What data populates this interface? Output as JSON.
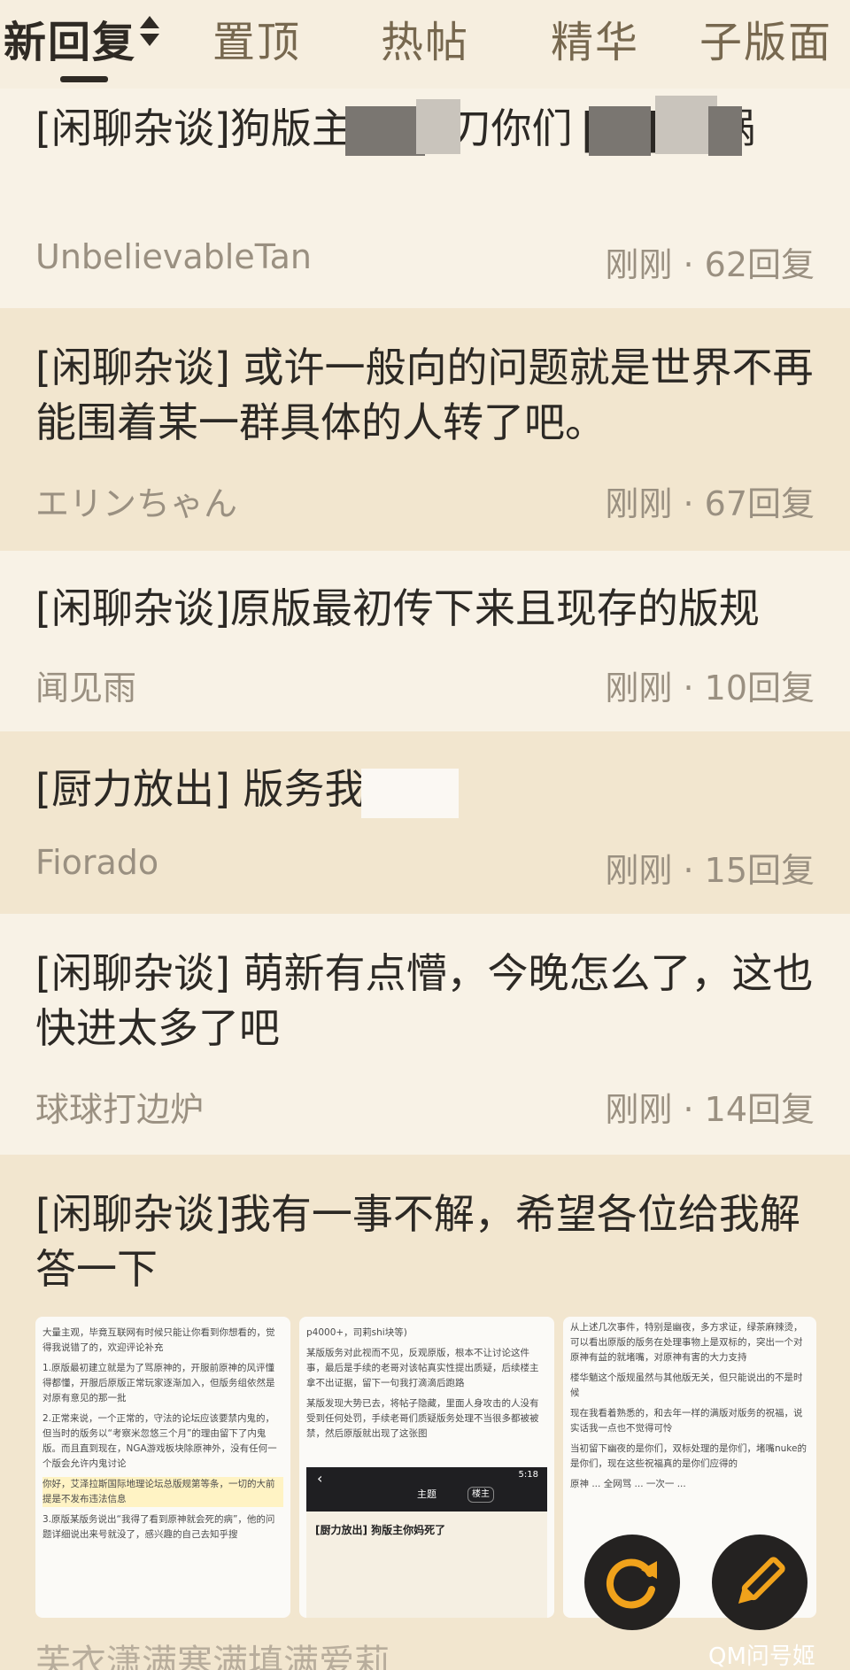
{
  "tabs": [
    {
      "label": "新回复",
      "active": true
    },
    {
      "label": "置顶",
      "active": false
    },
    {
      "label": "热帖",
      "active": false
    },
    {
      "label": "精华",
      "active": false
    },
    {
      "label": "子版面",
      "active": false
    }
  ],
  "threads": [
    {
      "title": "[闲聊杂谈]狗版主和 ▇ 刀你们 ▇ ▇ 帖锅",
      "author": "UnbelievableTan",
      "meta": "刚刚 · 62回复"
    },
    {
      "title": "[闲聊杂谈] 或许一般向的问题就是世界不再能围着某一群具体的人转了吧。",
      "author": "エリンちゃん",
      "meta": "刚刚 · 67回复"
    },
    {
      "title": "[闲聊杂谈]原版最初传下来且现存的版规",
      "author": "闻见雨",
      "meta": "刚刚 · 10回复"
    },
    {
      "title": "[厨力放出] 版务我        马",
      "author": "Fiorado",
      "meta": "刚刚 · 15回复"
    },
    {
      "title": "[闲聊杂谈] 萌新有点懵，今晚怎么了，这也快进太多了吧",
      "author": "球球打边炉",
      "meta": "刚刚 · 14回复"
    },
    {
      "title": "[闲聊杂谈]我有一事不解，希望各位给我解答一下",
      "author": "",
      "meta": ""
    }
  ],
  "thumbnails": [
    {
      "paragraphs": [
        "大量主观，毕竟互联网有时候只能让你看到你想看的，觉得我说错了的，欢迎评论补充",
        "1.原版最初建立就是为了骂原神的，开服前原神的风评懂得都懂，开服后原版正常玩家逐渐加入，但版务组依然是对原有意见的那一批",
        "2.正常来说，一个正常的，守法的论坛应该要禁内鬼的，但当时的版务以“考察米忽悠三个月”的理由留下了内鬼版。而且直到现在，NGA游戏板块除原神外，没有任何一个版会允许内鬼讨论",
        "你好，艾泽拉斯国际地理论坛总版规第等条，一切的大前提是不发布违法信息",
        "3.原版某版务说出“我得了看到原神就会死的病”，他的问题详细说出来号就没了，感兴趣的自己去知乎搜"
      ]
    },
    {
      "paragraphs": [
        "p4000+，司莉shi块等)",
        "某版版务对此视而不见，反观原版，根本不让讨论这件事，最后是手续的老哥对该帖真实性提出质疑，后续楼主拿不出证据，留下一句我打滴滴后跑路",
        "某版发现大势已去，将帖子隐藏，里面人身攻击的人没有受到任何处罚，手续老哥们质疑版务处理不当很多都被被禁，然后原版就出现了这张图"
      ],
      "mini_bar": "主题",
      "mini_badge": "楼主",
      "mini_time": "5:18",
      "mini_title": "[厨力放出] 狗版主你妈死了"
    },
    {
      "paragraphs": [
        "从上述几次事件，特别是幽夜，多方求证，绿茶麻辣烫，可以看出原版的版务在处理事物上是双标的，突出一个对原神有益的就堵嘴，对原神有害的大力支持",
        "楼华魈这个版规虽然与其他版无关，但只能说出的不是时候",
        "现在我看着熟悉的，和去年一样的满版对版务的祝福，说实话我一点也不觉得可怜",
        "当初留下幽夜的是你们，双标处理的是你们，堵嘴nuke的是你们，现在这些祝福真的是你们应得的",
        "原神 ... 全网骂 ... 一次一 ..."
      ]
    }
  ],
  "next_preview": "芙衣潇满寒满填满爱莉",
  "watermark": "QM问号姬",
  "colors": {
    "background": "#f6efe0",
    "alt_row": "#f2e6cf",
    "text": "#2c2925",
    "muted": "#9a9081",
    "fab": "#242221",
    "fab_icon": "#f0a21b"
  },
  "icons": {
    "sort": "sort-updown-icon",
    "refresh": "refresh-icon",
    "edit": "edit-pencil-icon"
  }
}
